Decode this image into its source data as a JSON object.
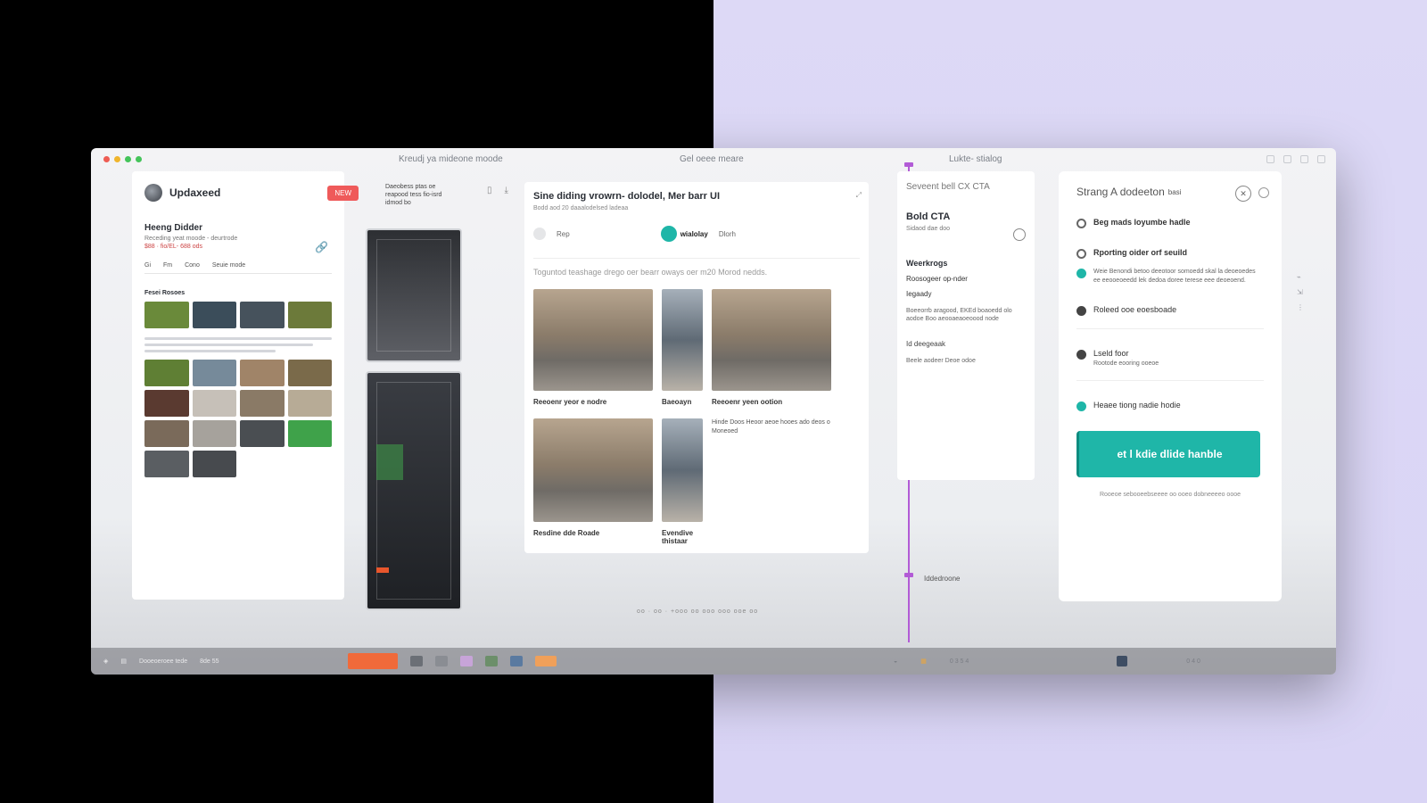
{
  "window": {
    "title_left": "Kreudj ya mideone moode",
    "title_center": "Gel oeee meare",
    "title_right": "Lukte- stialog"
  },
  "panel_a": {
    "brand": "Updaxeed",
    "new_button": "NEW",
    "title": "Heeng Didder",
    "subtitle": "Receding yeat moode - deurtrode",
    "meta": "$88 · fio/EL- 688 ods",
    "tabs": [
      "Gi",
      "Fm",
      "Cono",
      "Seuie mode"
    ],
    "section_label": "Fesei Rosoes",
    "colors": [
      "#6a8a3a",
      "#3b4d5a",
      "#46525c",
      "#6c7a3a",
      "#5f7f34",
      "#768a9a",
      "#a08468",
      "#7a6a4a",
      "#5a3a30",
      "#c6c0b8",
      "#8a7a66",
      "#b7ab96",
      "#7a6a5a",
      "#a6a29c",
      "#4a4e52",
      "#3fa24a",
      "#5a5e62",
      "#474a4e"
    ]
  },
  "phone_header": "Daeobess ptas oe reapood tess fio-isrd idmod bo",
  "panel_b": {
    "title": "Sine diding vrowrn- dolodel, Mer barr UI",
    "subtitle": "Bodd aod 20 daaalodelsed ladeaa",
    "tab_label": "Rep",
    "tab_active": "wialolay",
    "tab_third": "Dlorh",
    "description": "Toguntod teashage drego oer bearr oways oer m20 Morod nedds.",
    "cards": [
      {
        "caption": "Reeoenr yeor e nodre"
      },
      {
        "caption": "Baeoayn"
      },
      {
        "caption": "Reeoenr yeen ootion"
      },
      {
        "caption": "Resdine dde Roade"
      },
      {
        "caption": "Evendive thistaar"
      }
    ],
    "card_text": "Hinde Doos Heoor aeoe hooes ado deos o Moneoed"
  },
  "panel_c": {
    "top_label": "Seveent bell CX CTA",
    "head": "Bold CTA",
    "small": "Sidaod dae doo",
    "warnings": "Weerkrogs",
    "item1": "Roosogeer op-nder",
    "item2": "Iegaady",
    "paragraph": "Boeeorrb aragood, EKEd boaoedd olo aodoe Boo aeooaeaoeoood node",
    "section": "Id deegeaak",
    "section_sub": "Beele aodeer Deoe odoe",
    "footer": "Iddedroone"
  },
  "panel_d": {
    "head": "Strang A dodeeton",
    "head_suffix": "basi",
    "options": [
      {
        "label": "Beg mads loyumbe hadle",
        "desc": ""
      },
      {
        "label": "Rporting oider orf seuild",
        "desc": ""
      },
      {
        "label": "",
        "desc": "Weie Benondi betoo deeotoor somoedd skal la deoeoedes ee eeooeoeedd lek dedoa doree terese eee deoeoend."
      },
      {
        "label": "Roleed ooe eoesboade",
        "desc": ""
      },
      {
        "label": "Lseld foor",
        "desc": "Rootode eooring ooeoe"
      },
      {
        "label": "Heaee tiong nadie hodie",
        "desc": ""
      }
    ],
    "cta_label": "et l kdie dlide hanble",
    "footer": "Rooeoe sebooeebseeee oo ooeo dobneeeeo oooe"
  },
  "pagination": "oo · oo · +ooo oo ooo ooo ooe oo",
  "taskbar": {
    "left_label": "Dooeoeroee tede",
    "left_num": "8de 55",
    "right_time": "0 3 5 4",
    "right_end": "0 4 0"
  },
  "colors": {
    "accent": "#1fb6a8",
    "danger": "#ef5a5a",
    "guide": "#b25bd6"
  }
}
